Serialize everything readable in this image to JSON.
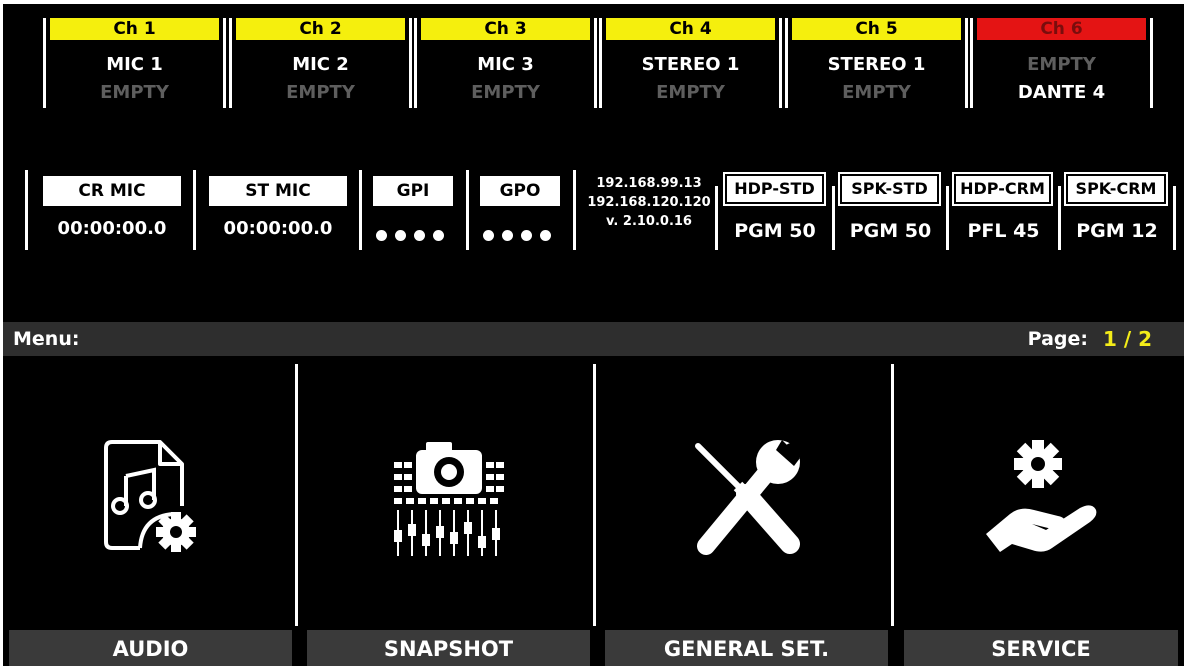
{
  "channels": [
    {
      "header": "Ch 1",
      "line1": "MIC 1",
      "line2": "EMPTY"
    },
    {
      "header": "Ch 2",
      "line1": "MIC 2",
      "line2": "EMPTY"
    },
    {
      "header": "Ch 3",
      "line1": "MIC 3",
      "line2": "EMPTY"
    },
    {
      "header": "Ch 4",
      "line1": "STEREO 1",
      "line2": "EMPTY"
    },
    {
      "header": "Ch 5",
      "line1": "STEREO 1",
      "line2": "EMPTY"
    },
    {
      "header": "Ch 6",
      "line1": "EMPTY",
      "line2": "DANTE 4"
    }
  ],
  "status": {
    "cr_mic": {
      "label": "CR MIC",
      "time": "00:00:00.0"
    },
    "st_mic": {
      "label": "ST MIC",
      "time": "00:00:00.0"
    },
    "gpi": {
      "label": "GPI"
    },
    "gpo": {
      "label": "GPO"
    },
    "network": {
      "ip1": "192.168.99.13",
      "ip2": "192.168.120.120",
      "version": "v. 2.10.0.16"
    },
    "monitors": [
      {
        "label": "HDP-STD",
        "value": "PGM 50"
      },
      {
        "label": "SPK-STD",
        "value": "PGM 50"
      },
      {
        "label": "HDP-CRM",
        "value": "PFL 45"
      },
      {
        "label": "SPK-CRM",
        "value": "PGM 12"
      }
    ]
  },
  "menu": {
    "label": "Menu:",
    "page_label": "Page:",
    "page_value": "1 / 2"
  },
  "tiles": [
    {
      "label": "AUDIO",
      "icon": "audio-file-gear-icon"
    },
    {
      "label": "SNAPSHOT",
      "icon": "camera-faders-icon"
    },
    {
      "label": "GENERAL SET.",
      "icon": "wrench-screwdriver-icon"
    },
    {
      "label": "SERVICE",
      "icon": "gear-hand-icon"
    }
  ],
  "colors": {
    "channel_header": "#f5ef0d",
    "channel_header_alert": "#e41414",
    "page_value": "#f3ec19",
    "dim_text": "#5e5e5e"
  }
}
